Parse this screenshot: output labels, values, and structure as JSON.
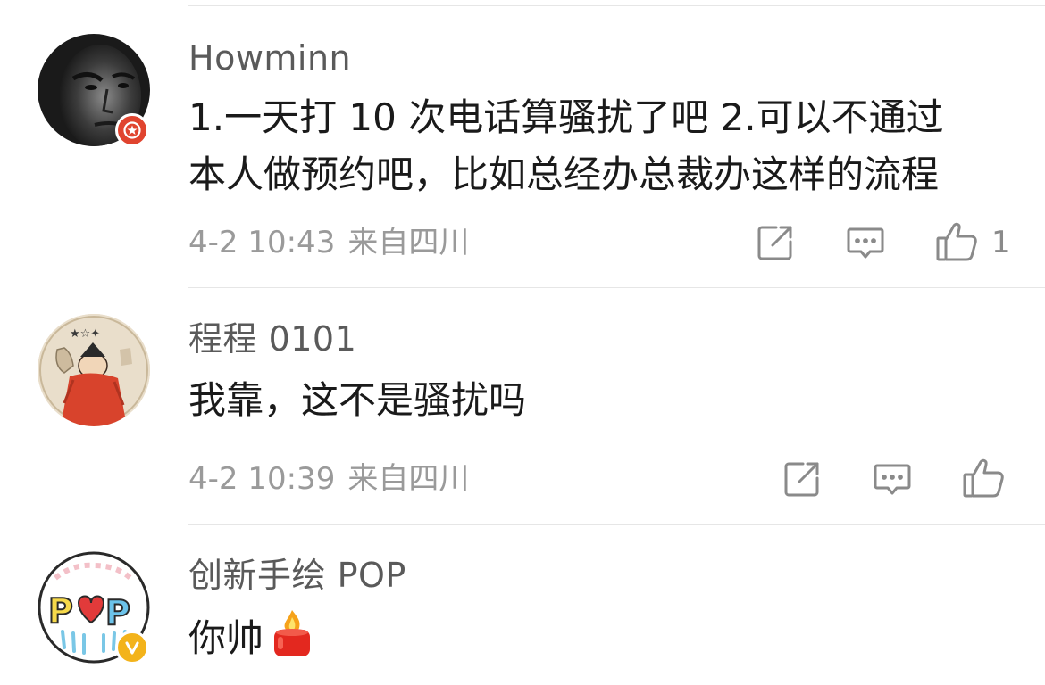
{
  "comments": [
    {
      "username": "Howminn",
      "content_lines": [
        "1.一天打 10 次电话算骚扰了吧 2.可以不通过",
        "本人做预约吧，比如总经办总裁办这样的流程"
      ],
      "time": "4-2 10:43",
      "source": "来自四川",
      "like_count": "1",
      "badge": "red-star-badge-icon",
      "avatar": "user-avatar-photo"
    },
    {
      "username": "程程 0101",
      "content_lines": [
        "我靠，这不是骚扰吗"
      ],
      "time": "4-2 10:39",
      "source": "来自四川",
      "like_count": "",
      "badge": "",
      "avatar": "user-avatar-drawing"
    },
    {
      "username": "创新手绘 POP",
      "content_lines": [
        "你帅"
      ],
      "emoji": "fire-emoji",
      "badge": "yellow-v-verified-icon",
      "avatar": "pop-logo-avatar"
    }
  ],
  "icons": {
    "share": "share-icon",
    "comment": "comment-icon",
    "like": "thumbs-up-icon"
  },
  "colors": {
    "username": "#5a5a5a",
    "content": "#1a1a1a",
    "meta": "#9a9a9a",
    "divider": "#e6e6e6",
    "badge_red": "#e0442f",
    "badge_yellow": "#f3b31b"
  }
}
